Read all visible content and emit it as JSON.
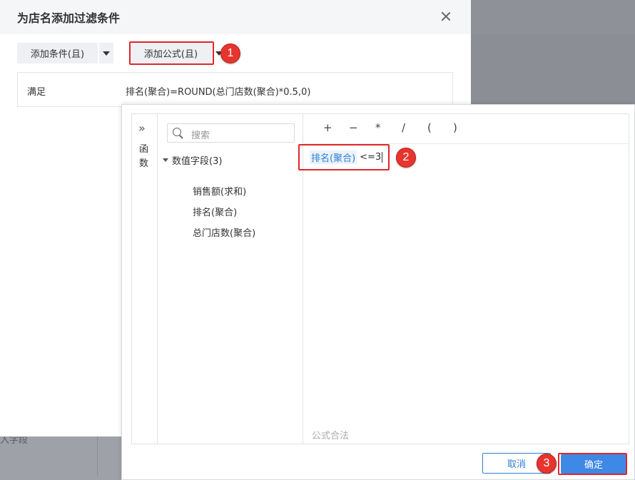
{
  "dialog": {
    "title": "为店名添加过滤条件",
    "add_condition_label": "添加条件(且)",
    "add_formula_label": "添加公式(且)",
    "condition_label": "满足",
    "condition_formula": "排名(聚合)=ROUND(总门店数(聚合)*0.5,0)",
    "icons": {
      "close": "close-icon",
      "dropdown": "caret-down-icon"
    }
  },
  "background": {
    "behind_text": "入字段"
  },
  "formula_editor": {
    "functions_tab_label": "函数",
    "expand_icon": "»",
    "search_placeholder": "搜索",
    "field_group": "数值字段(3)",
    "fields": [
      "销售额(求和)",
      "排名(聚合)",
      "总门店数(聚合)"
    ],
    "operators": [
      "+",
      "−",
      "*",
      "/",
      "(",
      ")"
    ],
    "formula_token": "排名(聚合)",
    "formula_rest": "<=3",
    "status": "公式合法",
    "cancel_label": "取消",
    "ok_label": "确定"
  },
  "callouts": [
    "1",
    "2",
    "3"
  ],
  "colors": {
    "accent": "#3e88e6",
    "callout": "#e8342e",
    "token": "#2f7fcf"
  }
}
